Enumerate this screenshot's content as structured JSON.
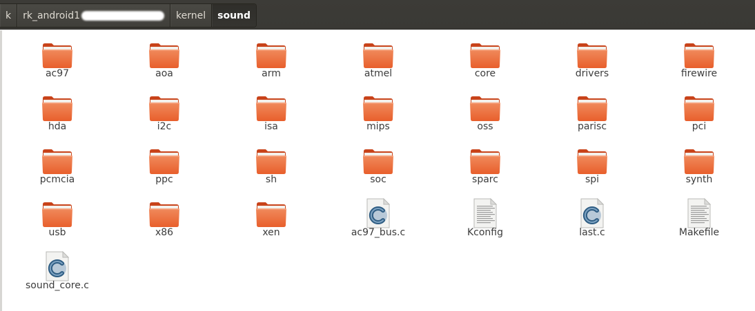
{
  "breadcrumbs": [
    {
      "label": "k",
      "active": false
    },
    {
      "label": "rk_android1",
      "active": false,
      "obscured": true
    },
    {
      "label": "kernel",
      "active": false
    },
    {
      "label": "sound",
      "active": true
    }
  ],
  "items": [
    {
      "name": "ac97",
      "type": "folder"
    },
    {
      "name": "aoa",
      "type": "folder"
    },
    {
      "name": "arm",
      "type": "folder"
    },
    {
      "name": "atmel",
      "type": "folder"
    },
    {
      "name": "core",
      "type": "folder"
    },
    {
      "name": "drivers",
      "type": "folder"
    },
    {
      "name": "firewire",
      "type": "folder"
    },
    {
      "name": "hda",
      "type": "folder"
    },
    {
      "name": "i2c",
      "type": "folder"
    },
    {
      "name": "isa",
      "type": "folder"
    },
    {
      "name": "mips",
      "type": "folder"
    },
    {
      "name": "oss",
      "type": "folder"
    },
    {
      "name": "parisc",
      "type": "folder"
    },
    {
      "name": "pci",
      "type": "folder"
    },
    {
      "name": "pcmcia",
      "type": "folder"
    },
    {
      "name": "ppc",
      "type": "folder"
    },
    {
      "name": "sh",
      "type": "folder"
    },
    {
      "name": "soc",
      "type": "folder"
    },
    {
      "name": "sparc",
      "type": "folder"
    },
    {
      "name": "spi",
      "type": "folder"
    },
    {
      "name": "synth",
      "type": "folder"
    },
    {
      "name": "usb",
      "type": "folder"
    },
    {
      "name": "x86",
      "type": "folder"
    },
    {
      "name": "xen",
      "type": "folder"
    },
    {
      "name": "ac97_bus.c",
      "type": "c-source"
    },
    {
      "name": "Kconfig",
      "type": "text"
    },
    {
      "name": "last.c",
      "type": "c-source"
    },
    {
      "name": "Makefile",
      "type": "text"
    },
    {
      "name": "sound_core.c",
      "type": "c-source"
    }
  ],
  "colors": {
    "folder_top": "#f08a5c",
    "folder_body": "#e85f2c",
    "folder_dark": "#c8431a",
    "toolbar": "#3c3b37",
    "label_text": "#3c3c3c"
  }
}
